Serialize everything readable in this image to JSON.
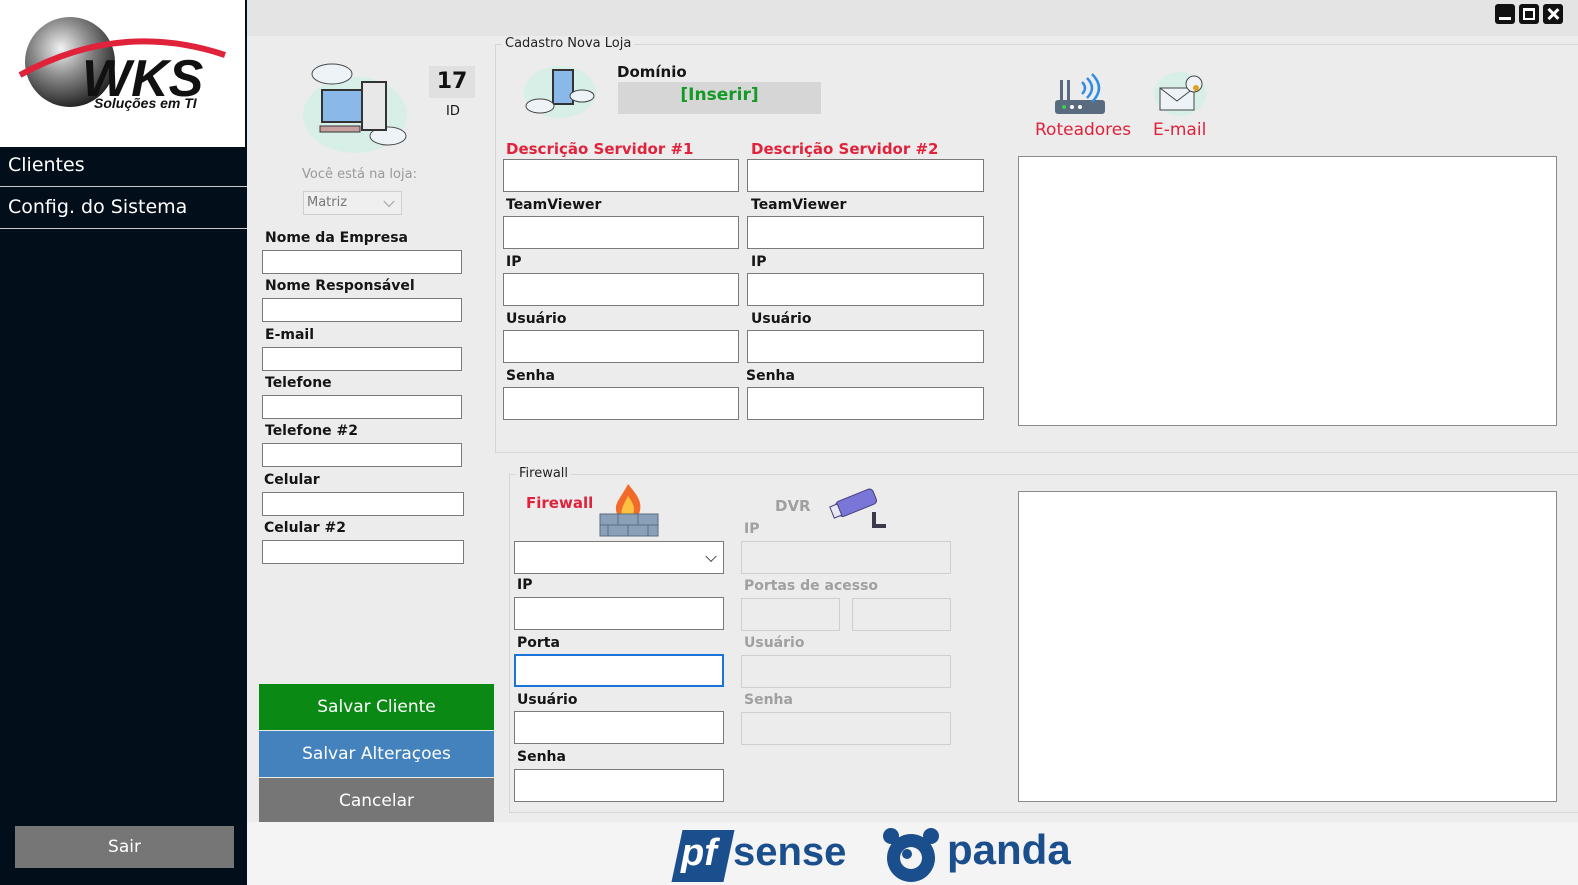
{
  "logo": {
    "brand": "WKS",
    "tagline": "Soluções em TI"
  },
  "sidebar": {
    "items": [
      {
        "label": "Clientes"
      },
      {
        "label": "Config. do Sistema"
      }
    ],
    "exit_label": "Sair"
  },
  "window_controls": {
    "minimize": "minimize-icon",
    "maximize": "maximize-icon",
    "close": "close-icon"
  },
  "client_panel": {
    "id_value": "17",
    "id_label": "ID",
    "store_prompt": "Você está na loja:",
    "store_selected": "Matriz",
    "fields": [
      {
        "label": "Nome da Empresa",
        "value": ""
      },
      {
        "label": "Nome Responsável",
        "value": ""
      },
      {
        "label": "E-mail",
        "value": ""
      },
      {
        "label": "Telefone",
        "value": ""
      },
      {
        "label": "Telefone #2",
        "value": ""
      },
      {
        "label": "Celular",
        "value": ""
      },
      {
        "label": "Celular #2",
        "value": ""
      }
    ],
    "buttons": {
      "save_client": "Salvar Cliente",
      "save_changes": "Salvar Alteraçoes",
      "cancel": "Cancelar"
    },
    "colors": {
      "save_client": "#0a8a15",
      "save_changes": "#4382bd",
      "cancel": "#767676"
    }
  },
  "store_group": {
    "title": "Cadastro Nova Loja",
    "domain_label": "Domínio",
    "domain_value": "[Inserir]",
    "server1": {
      "title": "Descrição Servidor #1",
      "labels": [
        "TeamViewer",
        "IP",
        "Usuário",
        "Senha"
      ]
    },
    "server2": {
      "title": "Descrição Servidor #2",
      "labels": [
        "TeamViewer",
        "IP",
        "Usuário",
        "Senha"
      ]
    },
    "links": [
      {
        "label": "Roteadores",
        "icon": "router-icon"
      },
      {
        "label": "E-mail",
        "icon": "email-icon"
      }
    ]
  },
  "firewall_group": {
    "title": "Firewall",
    "firewall_label": "Firewall",
    "firewall_selected": "",
    "labels": {
      "ip": "IP",
      "port": "Porta",
      "user": "Usuário",
      "password": "Senha"
    },
    "dvr": {
      "title": "DVR",
      "labels": {
        "ip": "IP",
        "ports": "Portas de acesso",
        "user": "Usuário",
        "password": "Senha"
      }
    }
  },
  "footer_logos": {
    "pfsense": "pfsense",
    "panda": "panda"
  },
  "accent_red": "#e0223b"
}
